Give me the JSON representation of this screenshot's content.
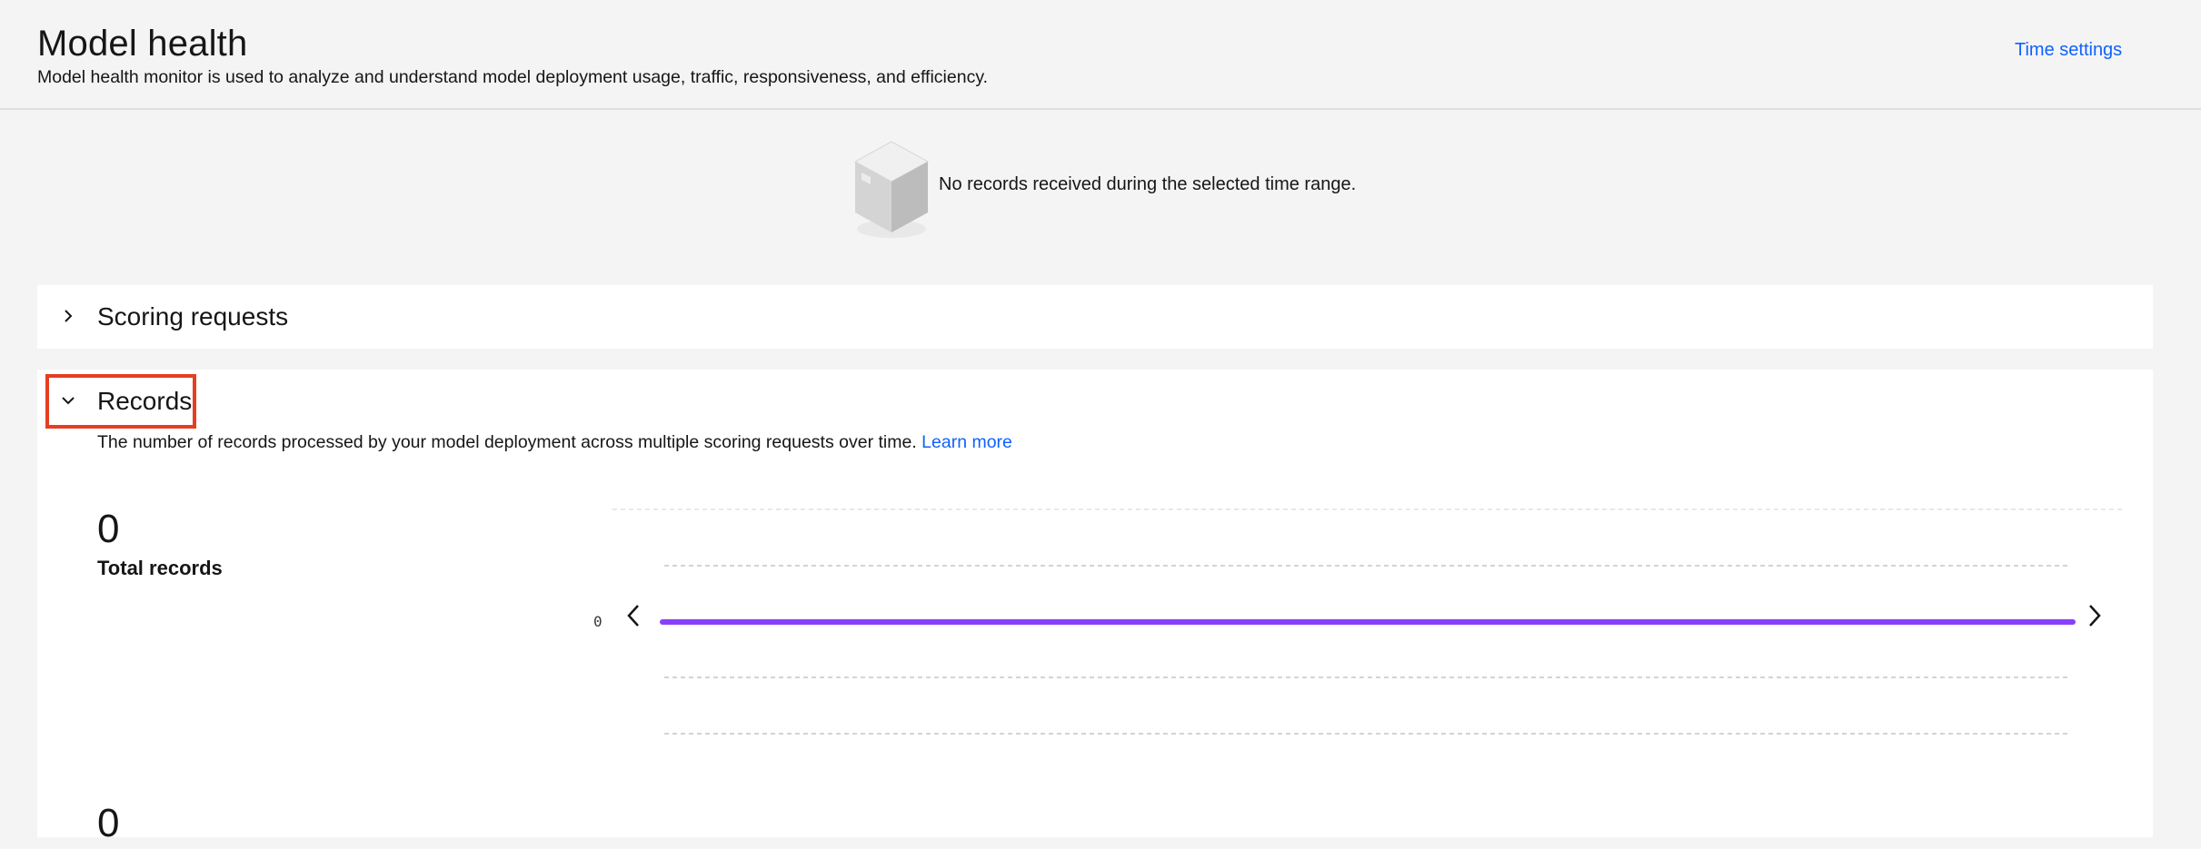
{
  "header": {
    "title": "Model health",
    "subtitle": "Model health monitor is used to analyze and understand model deployment usage, traffic, responsiveness, and efficiency.",
    "time_settings_label": "Time settings"
  },
  "empty_state": {
    "icon": "box-icon",
    "message": "No records received during the selected time range."
  },
  "sections": {
    "scoring": {
      "title": "Scoring requests",
      "expanded": false
    },
    "records": {
      "title": "Records",
      "expanded": true,
      "description": "The number of records processed by your model deployment across multiple scoring requests over time.",
      "learn_more": "Learn more",
      "total_value": "0",
      "total_label": "Total records",
      "second_value": "0"
    }
  },
  "chart_data": {
    "type": "line",
    "x": [
      0,
      1
    ],
    "series": [
      {
        "values": [
          0,
          0
        ],
        "color": "#8a3ffc"
      }
    ],
    "yticks": [
      "0"
    ],
    "grid": true
  }
}
